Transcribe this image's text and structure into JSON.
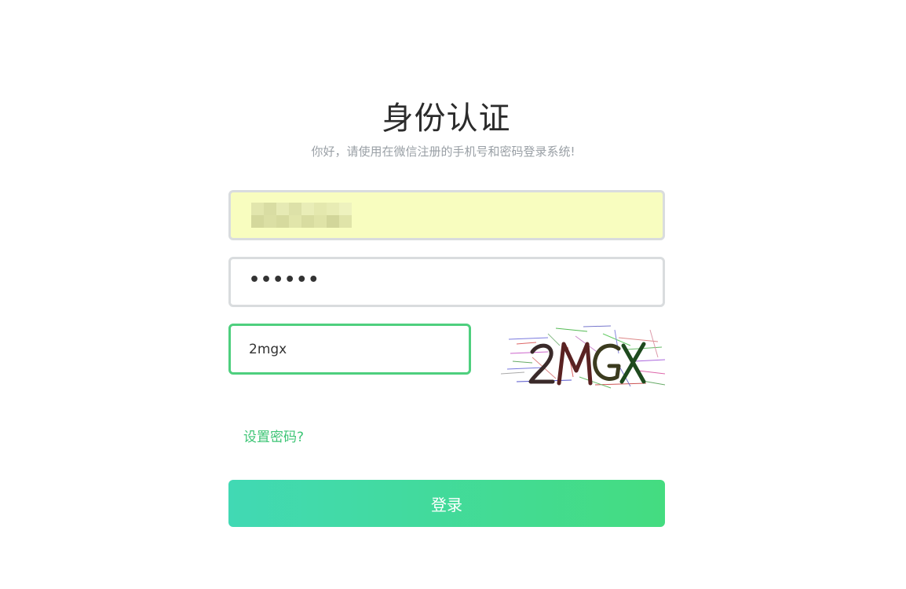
{
  "auth": {
    "title": "身份认证",
    "subtitle": "你好，请使用在微信注册的手机号和密码登录系统!"
  },
  "form": {
    "phone": {
      "value_obscured": true
    },
    "password": {
      "masked_value": "••••••"
    },
    "captcha": {
      "value": "2mgx",
      "image_text": "2MGX"
    },
    "set_password_link": "设置密码?",
    "login_button": "登录"
  },
  "colors": {
    "accent": "#3ec576",
    "button_gradient_start": "#41d9b4",
    "button_gradient_end": "#44dc80",
    "autofill_bg": "#f8fdbf"
  }
}
